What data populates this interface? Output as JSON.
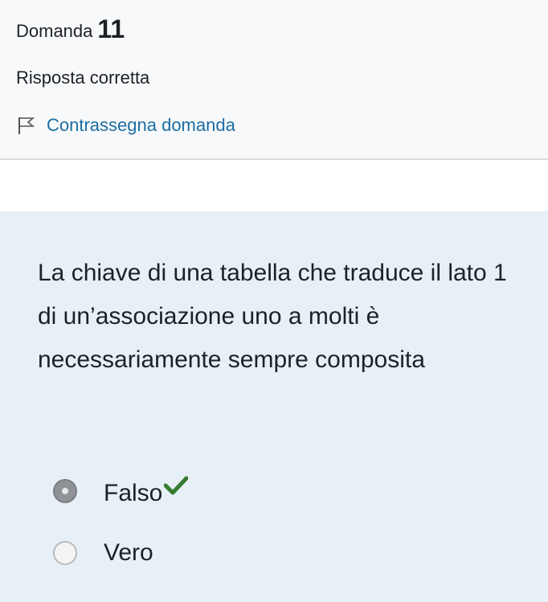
{
  "info": {
    "question_label": "Domanda",
    "question_number": "11",
    "state": "Risposta corretta",
    "flag_label": "Contrassegna domanda"
  },
  "question": {
    "text": "La chiave di una tabella che traduce il lato 1 di un’associazione uno a molti è necessariamente sempre composita",
    "answers": [
      {
        "label": "Falso",
        "selected": true,
        "correct": true,
        "icon": "check-icon"
      },
      {
        "label": "Vero",
        "selected": false,
        "correct": false
      }
    ]
  },
  "colors": {
    "link": "#1c6ea4",
    "correct": "#357a32",
    "content_background": "#e6f0f6",
    "info_background": "#f8f9fa"
  }
}
